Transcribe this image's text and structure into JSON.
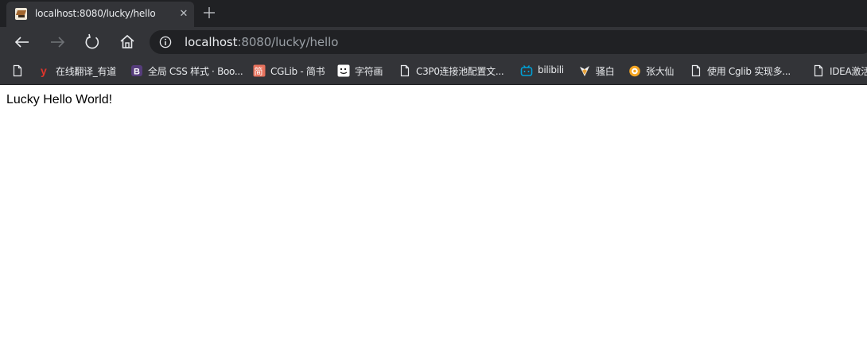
{
  "tab": {
    "title": "localhost:8080/lucky/hello",
    "close_glyph": "✕",
    "favicon": "tomcat-favicon-icon"
  },
  "new_tab": {
    "icon": "plus-icon"
  },
  "toolbar": {
    "back_icon": "arrow-left-icon",
    "forward_icon": "arrow-right-icon",
    "refresh_icon": "refresh-icon",
    "home_icon": "home-icon"
  },
  "address": {
    "host": "localhost",
    "rest": ":8080/lucky/hello",
    "info_icon": "info-circle-icon"
  },
  "bookmarks": [
    {
      "label": "",
      "icon": "page-icon"
    },
    {
      "label": "在线翻译_有道",
      "icon": "youdao-icon"
    },
    {
      "label": "全局 CSS 样式 · Boo...",
      "icon": "bootstrap-icon"
    },
    {
      "label": "CGLib - 简书",
      "icon": "jianshu-icon"
    },
    {
      "label": "字符画",
      "icon": "face-icon"
    },
    {
      "label": "C3P0连接池配置文...",
      "icon": "page-icon"
    },
    {
      "label": "bilibili",
      "icon": "bilibili-icon"
    },
    {
      "label": "骚白",
      "icon": "fox-icon"
    },
    {
      "label": "张大仙",
      "icon": "orange-icon"
    },
    {
      "label": "使用 Cglib 实现多...",
      "icon": "page-icon"
    },
    {
      "label": "IDEA激活",
      "icon": "page-icon"
    }
  ],
  "page": {
    "text": "Lucky Hello World!"
  },
  "colors": {
    "tabstrip_bg": "#202124",
    "toolbar_bg": "#333438",
    "address_bg": "#202124",
    "text_light": "#e8eaed",
    "text_dim": "#9aa0a6"
  }
}
